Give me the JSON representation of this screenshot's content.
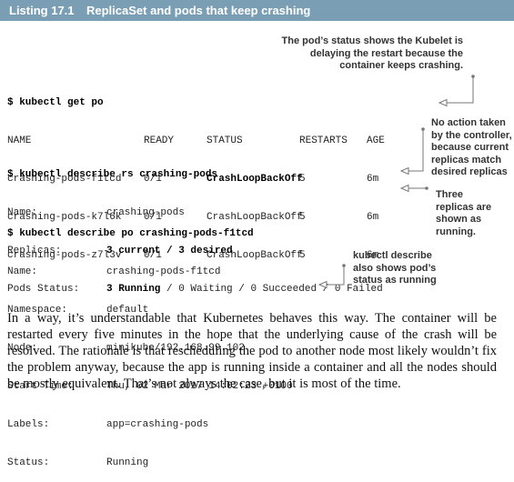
{
  "listing": {
    "number": "Listing 17.1",
    "title": "ReplicaSet and pods that keep crashing",
    "header_color": "#7a9fb4"
  },
  "annotations": {
    "kubelet_delay": [
      "The pod’s status shows the Kubelet is",
      "delaying the restart because the",
      "container keeps crashing."
    ],
    "no_action": [
      "No action taken",
      "by the controller,",
      "because current",
      "replicas match",
      "desired replicas"
    ],
    "three_running": [
      "Three",
      "replicas are",
      "shown as",
      "running."
    ],
    "describe_shows": [
      "kubectl describe",
      "also shows pod’s",
      "status as running"
    ]
  },
  "cmd_get_po": {
    "prompt": "$ kubectl get po",
    "headers": [
      "NAME",
      "READY",
      "STATUS",
      "RESTARTS",
      "AGE"
    ],
    "rows": [
      [
        "crashing-pods-f1tcd",
        "0/1",
        "CrashLoopBackOff",
        "5",
        "6m"
      ],
      [
        "crashing-pods-k7l6k",
        "0/1",
        "CrashLoopBackOff",
        "5",
        "6m"
      ],
      [
        "crashing-pods-z7l3v",
        "0/1",
        "CrashLoopBackOff",
        "5",
        "6m"
      ]
    ]
  },
  "cmd_describe_rs": {
    "prompt": "$ kubectl describe rs crashing-pods",
    "name_label": "Name:",
    "name_value": "crashing-pods",
    "replicas_label": "Replicas:",
    "replicas_value": "3 current / 3 desired",
    "status_label": "Pods Status:",
    "status_running": "3 Running",
    "status_rest": "/ 0 Waiting / 0 Succeeded / 0 Failed"
  },
  "cmd_describe_po": {
    "prompt": "$ kubectl describe po crashing-pods-f1tcd",
    "fields": [
      {
        "label": "Name:",
        "value": "crashing-pods-f1tcd"
      },
      {
        "label": "Namespace:",
        "value": "default"
      },
      {
        "label": "Node:",
        "value": "minikube/192.168.99.102"
      },
      {
        "label": "Start Time:",
        "value": "Thu, 02 Mar 2017 14:02:23 +0100"
      },
      {
        "label": "Labels:",
        "value": "app=crashing-pods"
      },
      {
        "label": "Status:",
        "value": "Running"
      }
    ]
  },
  "prose": "In a way, it’s understandable that Kubernetes behaves this way. The container will be restarted every five minutes in the hope that the underlying cause of the crash will be resolved. The rationale is that rescheduling the pod to another node most likely wouldn’t fix the problem anyway, because the app is running inside a container and all the nodes should be mostly equivalent. That’s not always the case, but it is most of the time."
}
